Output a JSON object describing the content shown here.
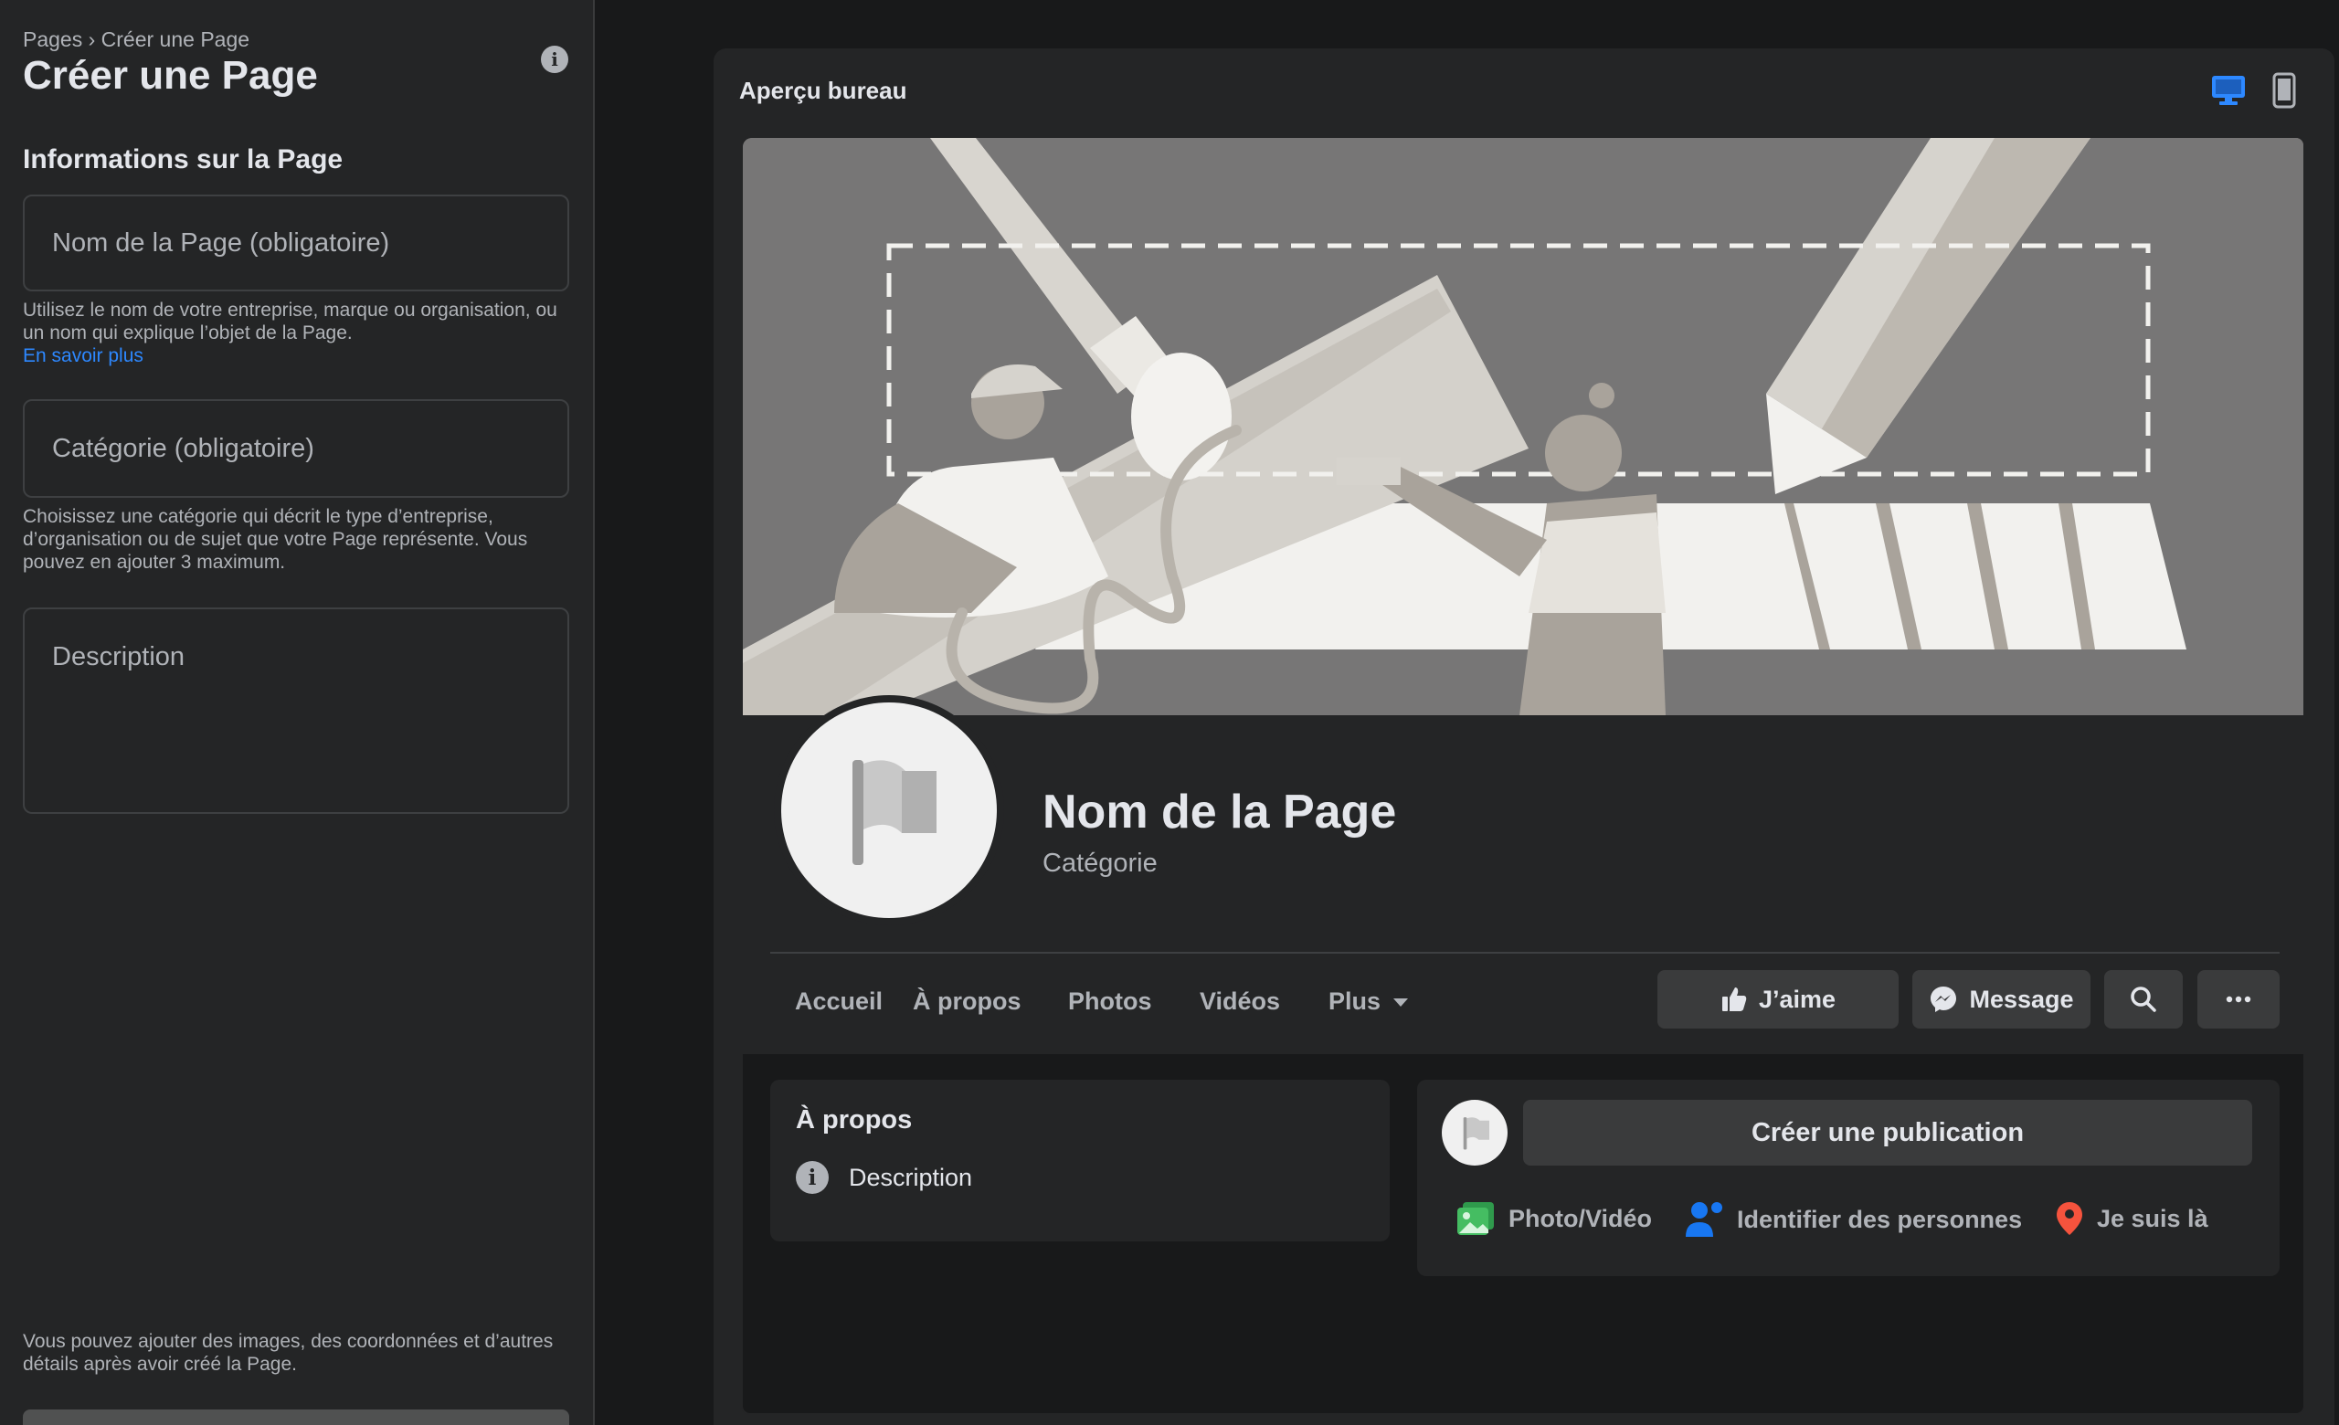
{
  "left_panel": {
    "breadcrumb": "Pages › Créer une Page",
    "title": "Créer une Page",
    "section_title": "Informations sur la Page",
    "name_placeholder": "Nom de la Page (obligatoire)",
    "name_hint": "Utilisez le nom de votre entreprise, marque ou organisation, ou un nom qui explique l’objet de la Page.",
    "learn_more": "En savoir plus",
    "category_placeholder": "Catégorie (obligatoire)",
    "category_hint": "Choisissez une catégorie qui décrit le type d’entreprise, d’organisation ou de sujet que votre Page représente. Vous pouvez en ajouter 3 maximum.",
    "description_placeholder": "Description",
    "footer_note": "Vous pouvez ajouter des images, des coordonnées et d’autres détails après avoir créé la Page."
  },
  "preview": {
    "title": "Aperçu bureau",
    "page_name": "Nom de la Page",
    "page_category": "Catégorie",
    "tabs": [
      "Accueil",
      "À propos",
      "Photos",
      "Vidéos",
      "Plus"
    ],
    "buttons": {
      "like": "J’aime",
      "message": "Message"
    },
    "about_card": {
      "title": "À propos",
      "description": "Description"
    },
    "post_card": {
      "create_post": "Créer une publication",
      "photo_video": "Photo/Vidéo",
      "tag_people": "Identifier des personnes",
      "check_in": "Je suis là"
    }
  },
  "colors": {
    "background": "#18191a",
    "panel": "#242526",
    "accent": "#2d88ff",
    "button": "#3a3b3c"
  }
}
